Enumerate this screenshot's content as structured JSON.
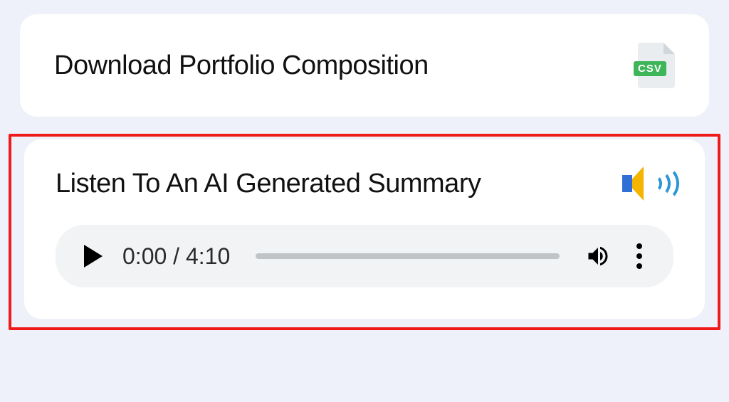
{
  "download_card": {
    "title": "Download Portfolio Composition",
    "file_type_label": "CSV"
  },
  "summary_card": {
    "title": "Listen To An AI Generated Summary",
    "audio_player": {
      "current_time": "0:00",
      "duration": "4:10",
      "time_separator": " / "
    }
  }
}
